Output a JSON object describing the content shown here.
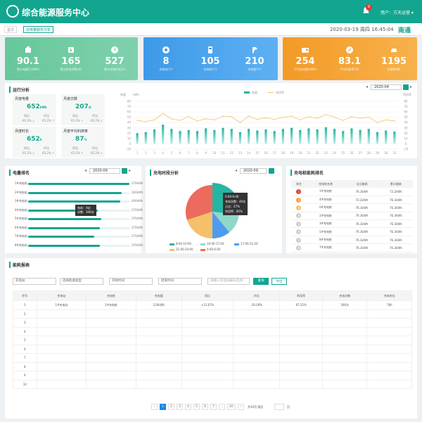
{
  "header": {
    "title": "综合能源服务中心",
    "notif": "9",
    "user_text": "用户：方天运营 ▾"
  },
  "tabs": [
    "首页",
    "充电量服务分析"
  ],
  "datetime": "2020-03-19 周四 16:45:04",
  "city": "南通",
  "kpi": [
    {
      "value": "90.1",
      "label": "累计电量(万kWh)",
      "icon": "battery-icon"
    },
    {
      "value": "165",
      "label": "累计充电次数(次)",
      "icon": "charger-icon"
    },
    {
      "value": "527",
      "label": "累计充电时长(h)",
      "icon": "clock-icon"
    },
    {
      "value": "8",
      "label": "充电站(个)",
      "icon": "station-icon"
    },
    {
      "value": "105",
      "label": "充电桩(个)",
      "icon": "pile-icon"
    },
    {
      "value": "210",
      "label": "充电枪(个)",
      "icon": "gun-icon"
    },
    {
      "value": "254",
      "label": "平均充电量(kWh)",
      "icon": "wallet-icon"
    },
    {
      "value": "83.1",
      "label": "平均利用率(%)",
      "icon": "rate-icon"
    },
    {
      "value": "1195",
      "label": "车辆数(辆)",
      "icon": "car-icon"
    }
  ],
  "colors": {
    "green": "#12a58f",
    "blue": "#3d9ae8",
    "orange": "#f5a02c",
    "pie": [
      "#26b5a3",
      "#8fd8c9",
      "#4f9bf0",
      "#f5c06a",
      "#ec6b5e"
    ]
  },
  "run": {
    "title": "运行分析",
    "date": "2020-04",
    "stats": [
      {
        "head": "月度电量",
        "value": "652",
        "unit": "kWh",
        "l1": "同比",
        "l2": "环比",
        "n1": "65.2% ↓",
        "n2": "65.2% ↑"
      },
      {
        "head": "月度次数",
        "value": "207",
        "unit": "次",
        "l1": "同比",
        "l2": "环比",
        "n1": "65.2% ↑",
        "n2": "65.2% ↓"
      },
      {
        "head": "月度时长",
        "value": "652",
        "unit": "h",
        "l1": "同比",
        "l2": "环比",
        "n1": "65.2% ↓",
        "n2": "65.2% ↑"
      },
      {
        "head": "月度平均利用率",
        "value": "87",
        "unit": "%",
        "l1": "同比",
        "l2": "环比",
        "n1": "65.2% ↑",
        "n2": "65.2% ↓"
      }
    ]
  },
  "rank": {
    "title": "电量排名",
    "date": "2020-09",
    "tooltip": "电站：4站\n次数：306次",
    "rows": [
      {
        "label": "1#充电站",
        "pct": 0.99,
        "val": "370kWh"
      },
      {
        "label": "2#充电站",
        "pct": 0.92,
        "val": "300kWh"
      },
      {
        "label": "3#充电站",
        "pct": 0.9,
        "val": "400kWh"
      },
      {
        "label": "4#充电站",
        "pct": 0.68,
        "val": "270kWh"
      },
      {
        "label": "5#充电站",
        "pct": 0.72,
        "val": "370kWh"
      },
      {
        "label": "6#充电站",
        "pct": 0.7,
        "val": "370kWh"
      },
      {
        "label": "7#充电站",
        "pct": 0.65,
        "val": "270kWh"
      },
      {
        "label": "8#充电站",
        "pct": 0.7,
        "val": "370kWh"
      }
    ]
  },
  "period": {
    "title": "充电时段分析",
    "date": "2020-09",
    "tooltip": "0:00-6:00\n充电次数：40次\n占比：27%\n利用率：85%",
    "legend": [
      "8:00-10:00",
      "10:00-17:00",
      "17:00-21:00",
      "21:00-24:00",
      "0:00-6:00"
    ]
  },
  "energy": {
    "title": "充电桩能耗排名",
    "cols": [
      "排名",
      "充电桩名称",
      "当日能耗",
      "累计能耗"
    ],
    "rows": [
      [
        "1",
        "1#充电桩",
        "76.3kWh",
        "73.2kWh"
      ],
      [
        "2",
        "4#充电桩",
        "73.2kWh",
        "76.3kWh"
      ],
      [
        "3",
        "6#充电桩",
        "76.3kWh",
        "76.3kWh"
      ],
      [
        "4",
        "2#充电桩",
        "76.3kWh",
        "76.3kWh"
      ],
      [
        "5",
        "3#充电桩",
        "76.3kWh",
        "76.3kWh"
      ],
      [
        "6",
        "5#充电桩",
        "76.3kWh",
        "76.3kWh"
      ],
      [
        "7",
        "8#充电桩",
        "76.3kWh",
        "76.3kWh"
      ],
      [
        "8",
        "7#充电桩",
        "76.3kWh",
        "76.3kWh"
      ]
    ]
  },
  "report": {
    "title": "能耗报表",
    "f1": "充电站",
    "f2": "选择能源类型",
    "start": "开始时间",
    "end": "结束时间",
    "search_ph": "请输入充电站编码/名称",
    "query": "查询",
    "export": "导出",
    "cols": [
      "序号",
      "充电站",
      "充电桩",
      "充电量",
      "同比",
      "环比",
      "利用率",
      "充电次数",
      "充电时长"
    ],
    "rows": [
      [
        "1",
        "1#充电站",
        "1#充电桩",
        "120kWh",
        "+12.67%",
        "-26.09%",
        "87.52%",
        "306次",
        "78h"
      ]
    ],
    "blank": [
      "2",
      "3",
      "4",
      "5",
      "6",
      "7",
      "8",
      "9",
      "10"
    ]
  },
  "pager": {
    "pages": [
      "1",
      "2",
      "3",
      "4",
      "5",
      "6",
      "7",
      "...",
      "20"
    ],
    "goto": "共20页 跳至",
    "page": "页"
  },
  "chart_data": {
    "type": "bar",
    "ylabel_left": "电量",
    "unit": "kWh",
    "ylabel_right": "利用率",
    "legend": [
      "电量",
      "利用率"
    ],
    "x": [
      1,
      2,
      3,
      4,
      5,
      6,
      7,
      8,
      9,
      10,
      11,
      12,
      13,
      14,
      15,
      16,
      17,
      18,
      19,
      20,
      21,
      22,
      23,
      24,
      25,
      26,
      27,
      28,
      29,
      30,
      31
    ],
    "ylim": [
      -10,
      80
    ],
    "yticks": [
      -10,
      0,
      10,
      20,
      30,
      40,
      50,
      60,
      70,
      80
    ],
    "ylim_right": [
      -10,
      80
    ],
    "series": [
      {
        "name": "电量",
        "type": "bar",
        "values": [
          20,
          22,
          27,
          36,
          28,
          24,
          26,
          24,
          29,
          26,
          30,
          28,
          22,
          28,
          25,
          27,
          24,
          28,
          30,
          26,
          29,
          27,
          31,
          28,
          24,
          29,
          26,
          28,
          22,
          25,
          23
        ]
      },
      {
        "name": "利用率",
        "type": "line",
        "values": [
          44,
          42,
          45,
          57,
          47,
          44,
          51,
          43,
          47,
          45,
          52,
          51,
          40,
          52,
          46,
          49,
          46,
          50,
          52,
          45,
          51,
          48,
          55,
          50,
          44,
          51,
          48,
          50,
          40,
          45,
          43
        ]
      }
    ]
  }
}
